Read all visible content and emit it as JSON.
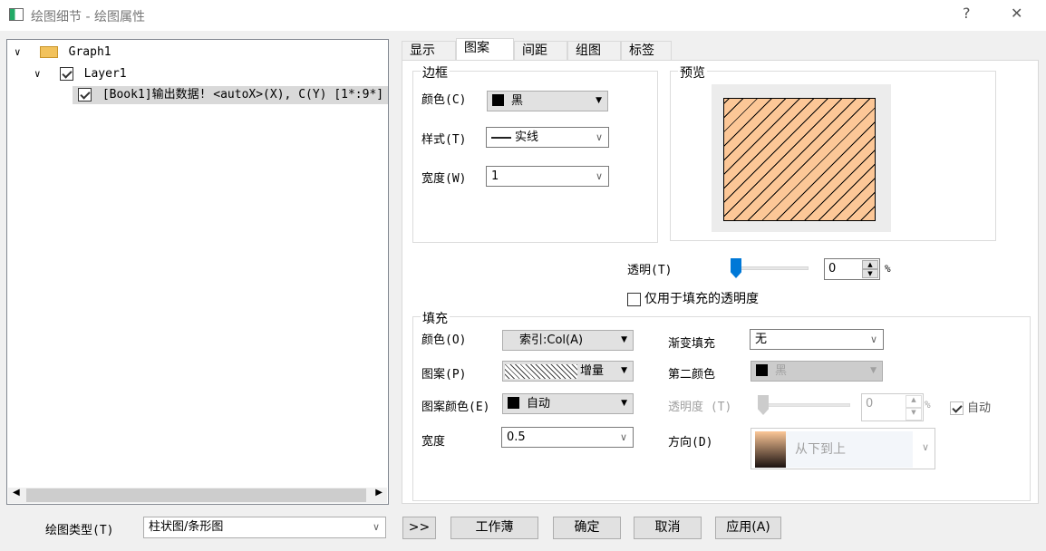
{
  "window": {
    "title": "绘图细节 - 绘图属性",
    "help": "?",
    "close": "✕"
  },
  "tree": {
    "root": "Graph1",
    "layer": "Layer1",
    "plot": "[Book1]输出数据! <autoX>(X), C(Y) [1*:9*]"
  },
  "tabs": [
    "显示",
    "图案",
    "间距",
    "组图",
    "标签"
  ],
  "border": {
    "title": "边框",
    "color_label": "颜色(C)",
    "color_value": "黑",
    "style_label": "样式(T)",
    "style_value": "实线",
    "width_label": "宽度(W)",
    "width_value": "1"
  },
  "preview": {
    "title": "预览",
    "fill_color": "#fcc797",
    "hatch_color": "#000000"
  },
  "transparency": {
    "label": "透明(T)",
    "value": "0",
    "unit": "%",
    "percent": 0,
    "fill_only_label": "仅用于填充的透明度",
    "fill_only_checked": false
  },
  "fill": {
    "title": "填充",
    "color_label": "颜色(O)",
    "color_value": "索引:Col(A)",
    "pattern_label": "图案(P)",
    "pattern_value": "增量",
    "pattern_color_label": "图案颜色(E)",
    "pattern_color_value": "自动",
    "width_label": "宽度",
    "width_value": "0.5",
    "gradient_label": "渐变填充",
    "gradient_value": "无",
    "second_color_label": "第二颜色",
    "second_color_value": "黑",
    "opacity_label": "透明度 (T)",
    "opacity_value": "0",
    "opacity_unit": "%",
    "auto_label": "自动",
    "auto_checked": true,
    "direction_label": "方向(D)",
    "direction_value": "从下到上"
  },
  "footer": {
    "plot_type_label": "绘图类型(T)",
    "plot_type_value": "柱状图/条形图",
    "expand": ">>",
    "workbook": "工作薄",
    "ok": "确定",
    "cancel": "取消",
    "apply": "应用(A)"
  },
  "colors": {
    "accent": "#0078d7"
  }
}
